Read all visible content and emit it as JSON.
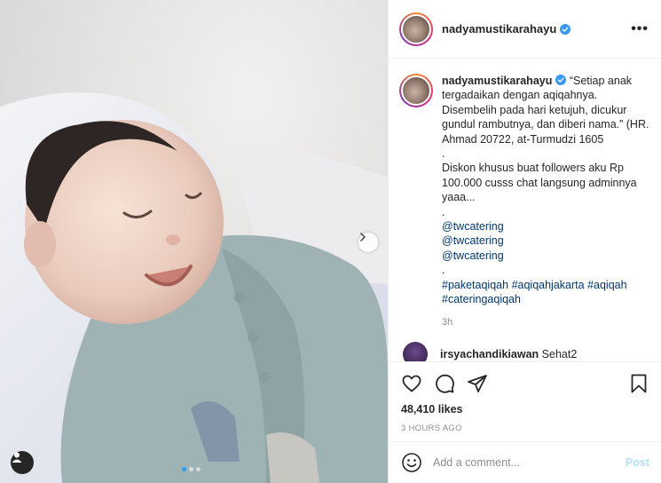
{
  "post": {
    "username": "nadyamustikarahayu",
    "verified": true,
    "more_label": "•••",
    "carousel": {
      "slide_count": 3,
      "active_index": 0
    }
  },
  "caption": {
    "username": "nadyamustikarahayu",
    "lines": [
      "“Setiap anak tergadaikan dengan aqiqahnya. Disembelih pada hari ketujuh, dicukur gundul rambutnya, dan diberi nama.” (HR. Ahmad 20722, at-Turmudzi 1605",
      ".",
      "Diskon khusus buat followers aku Rp 100.000 cusss chat langsung adminnya yaaa...",
      "."
    ],
    "mentions": [
      "@twcatering",
      "@twcatering",
      "@twcatering"
    ],
    "dot": ".",
    "hashtags": [
      "#paketaqiqah",
      "#aqiqahjakarta",
      "#aqiqah",
      "#cateringaqiqah"
    ],
    "time": "3h"
  },
  "reply": {
    "username": "irsyachandikiawan",
    "text": "Sehat2"
  },
  "actions": {
    "likes": "48,410 likes",
    "posted": "3 HOURS AGO"
  },
  "comment_box": {
    "placeholder": "Add a comment...",
    "post_label": "Post"
  },
  "colors": {
    "link": "#00376b",
    "verified": "#3897f0",
    "post_disabled": "#b2dffc",
    "muted": "#8e8e8e"
  },
  "icons": [
    "chevron-right-icon",
    "user-tag-icon",
    "verified-icon",
    "more-icon",
    "heart-icon",
    "comment-icon",
    "share-icon",
    "bookmark-icon",
    "emoji-icon"
  ]
}
